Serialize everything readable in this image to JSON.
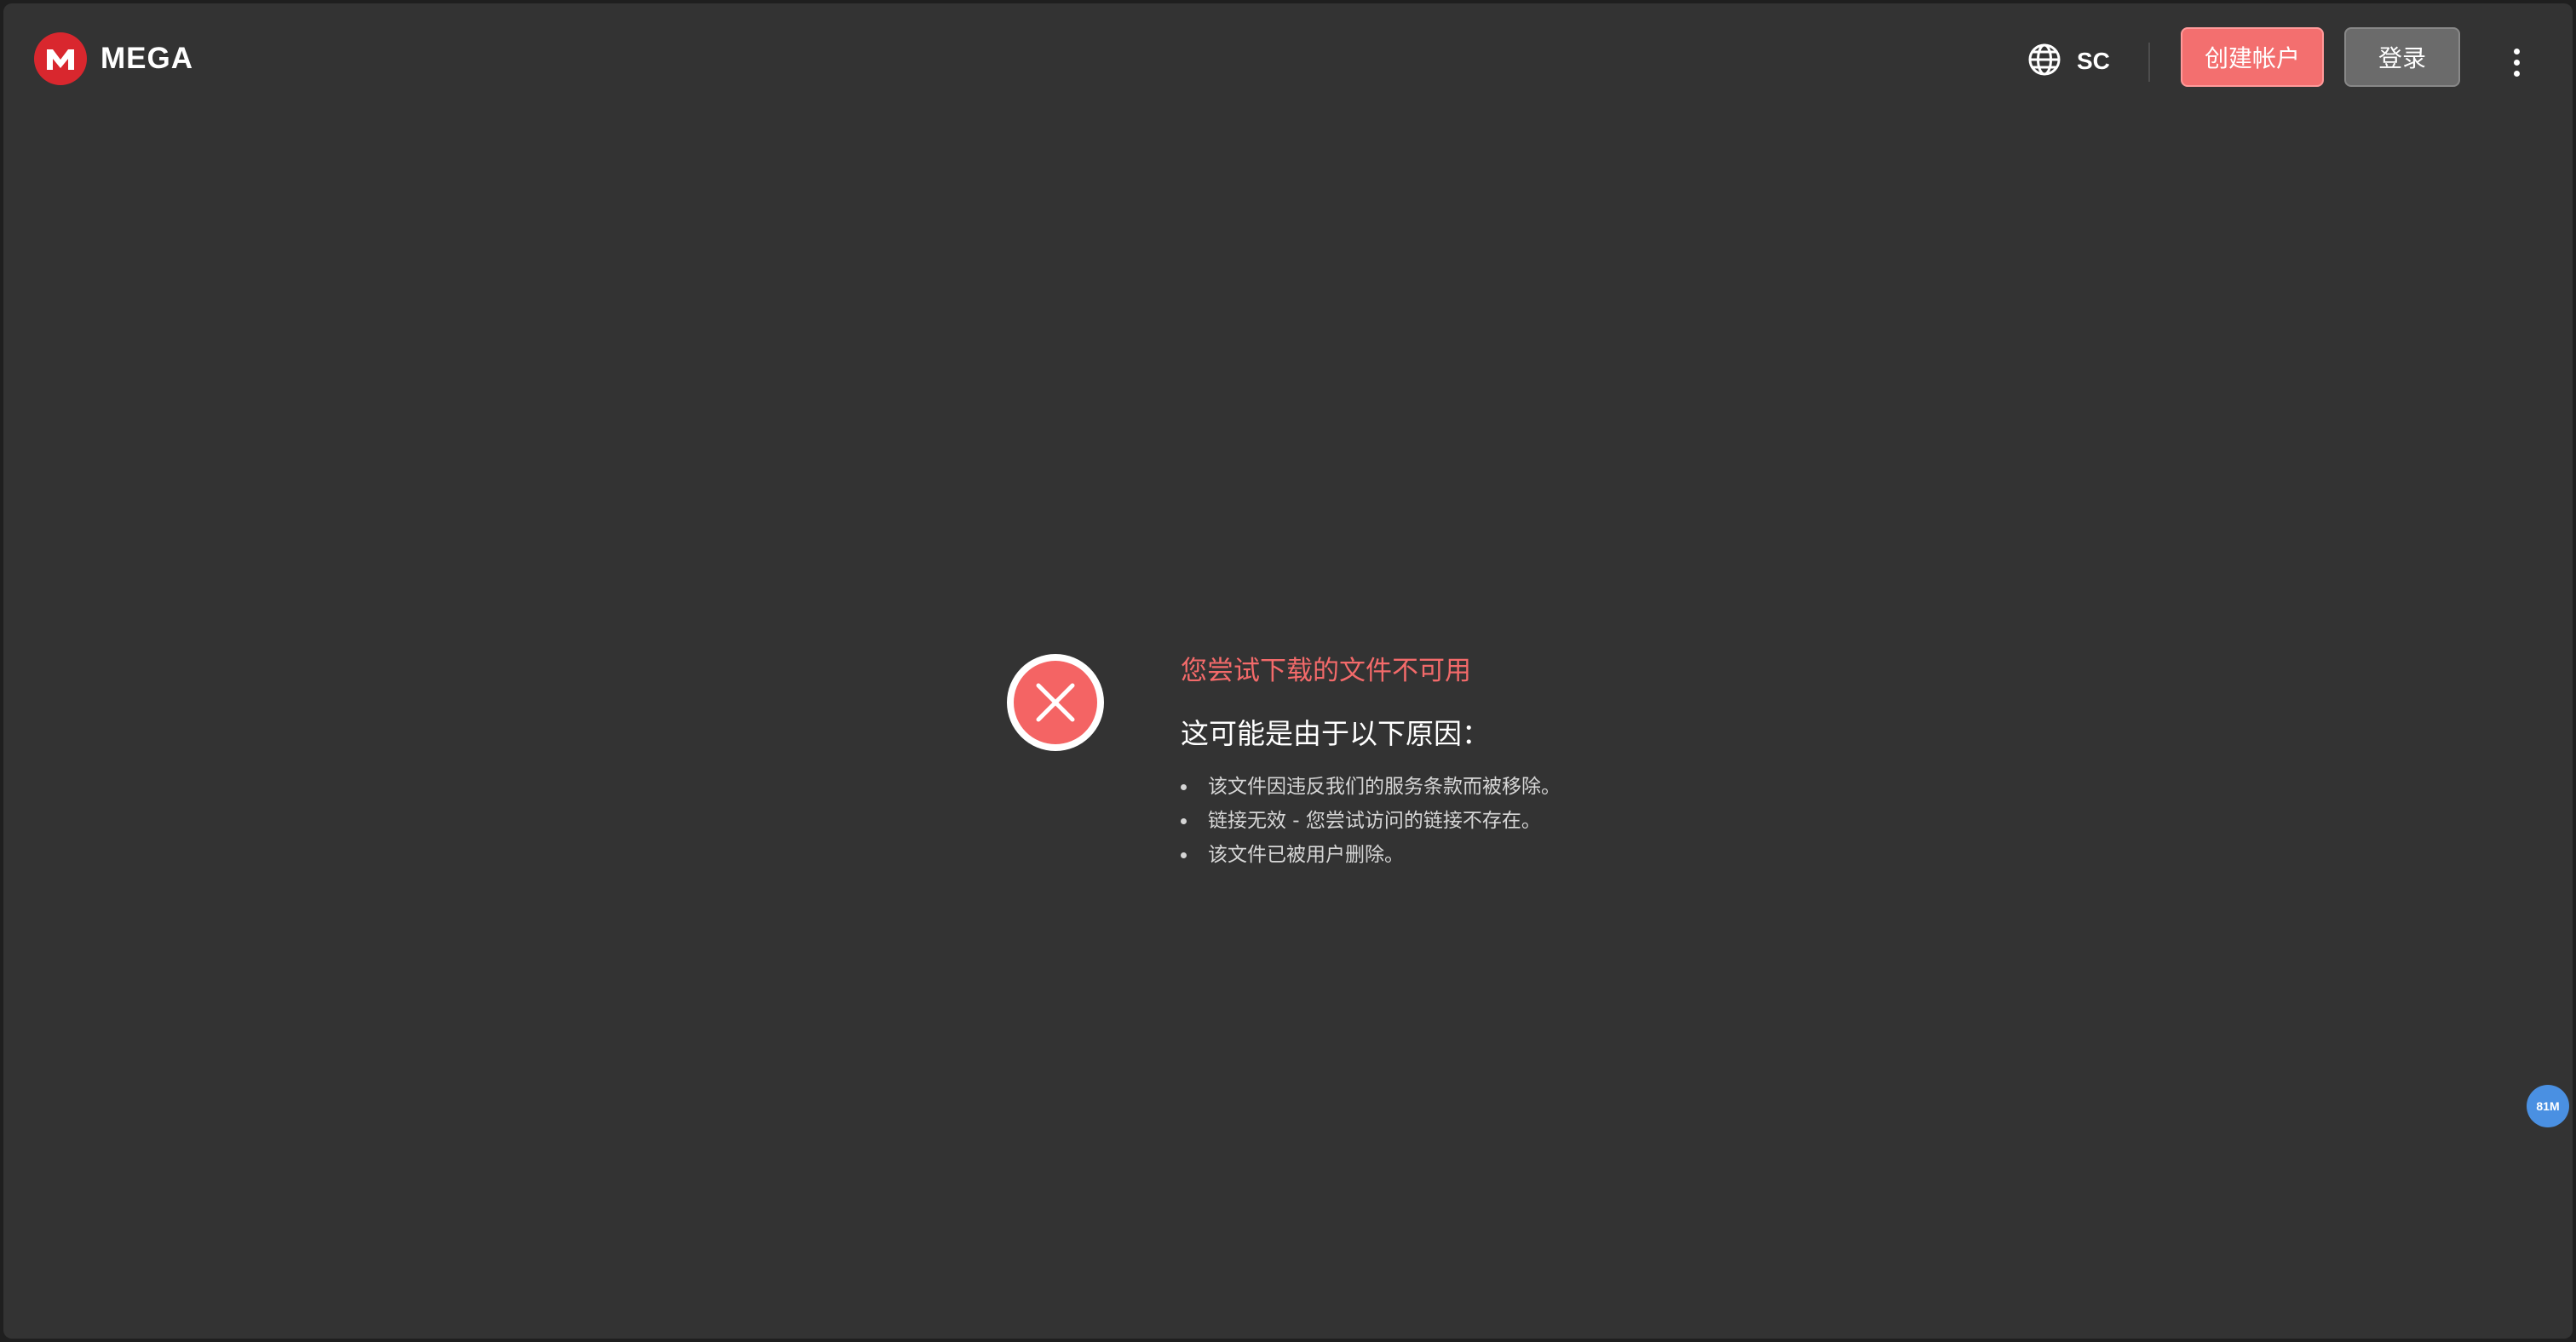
{
  "header": {
    "brand": "MEGA",
    "logo_letter": "M",
    "language_code": "SC",
    "create_account_label": "创建帐户",
    "login_label": "登录"
  },
  "error": {
    "title": "您尝试下载的文件不可用",
    "subtitle": "这可能是由于以下原因：",
    "reasons": [
      "该文件因违反我们的服务条款而被移除。",
      "链接无效 - 您尝试访问的链接不存在。",
      "该文件已被用户删除。"
    ]
  },
  "perf_badge": "81M",
  "colors": {
    "background": "#333333",
    "brand_red": "#d9272e",
    "create_button": "#f36f6f",
    "login_button": "#6b6b6b",
    "error_red": "#f46464",
    "badge_blue": "#4a90e2"
  },
  "icons": [
    "mega-logo-icon",
    "globe-icon",
    "more-vertical-icon",
    "error-x-icon"
  ]
}
